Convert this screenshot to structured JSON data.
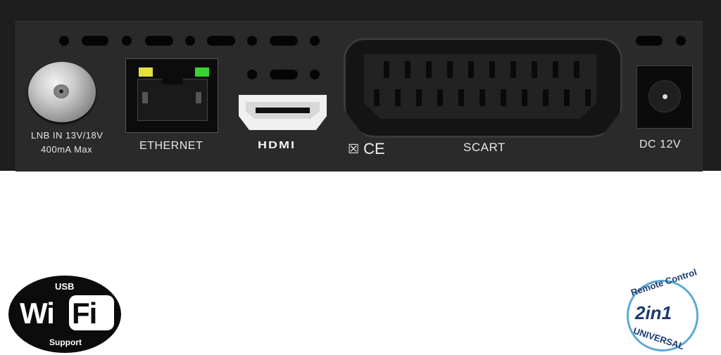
{
  "panel": {
    "lnb_line1": "LNB IN 13V/18V",
    "lnb_line2": "400mA Max",
    "ethernet_label": "ETHERNET",
    "hdmi_label": "HDMI",
    "scart_label": "SCART",
    "dc_label": "DC 12V",
    "ce_mark": "CE",
    "weee_symbol": "☒"
  },
  "badges": {
    "wifi": {
      "top": "USB",
      "wi": "Wi",
      "fi": "Fi",
      "bottom": "Support"
    },
    "remote": {
      "top": "Remote Control",
      "center": "2in1",
      "bottom": "UNIVERSAL"
    }
  },
  "colors": {
    "led_yellow": "#e4e03a",
    "led_green": "#39d42f",
    "remote_blue": "#1d3a70",
    "remote_ring": "#5aa9d8"
  }
}
